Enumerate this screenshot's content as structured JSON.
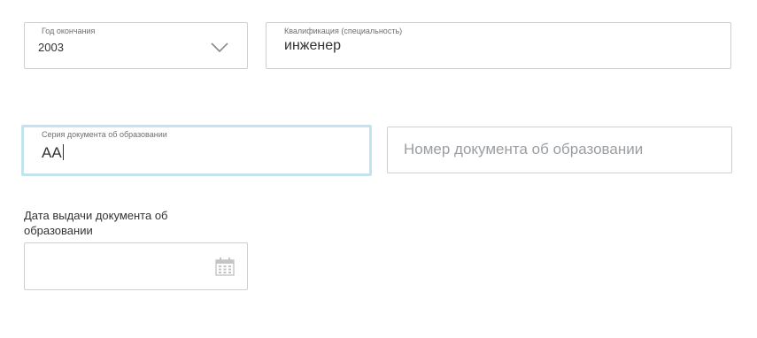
{
  "graduation_year": {
    "label": "Год окончания",
    "value": "2003",
    "icon": "chevron-down-icon"
  },
  "qualification": {
    "label": "Квалификация (специальность)",
    "value": "инженер"
  },
  "document_series": {
    "label": "Серия документа об образовании",
    "value": "АА"
  },
  "document_number": {
    "placeholder": "Номер документа об образовании",
    "value": ""
  },
  "issue_date": {
    "label_line1": "Дата выдачи документа об",
    "label_line2": "образовании",
    "value": "",
    "icon": "calendar-icon"
  },
  "colors": {
    "border": "#cfcfcf",
    "focus_border": "#c3e3f1",
    "text": "#333333",
    "placeholder": "#9a9ea2",
    "icon": "#c4c4c4"
  }
}
